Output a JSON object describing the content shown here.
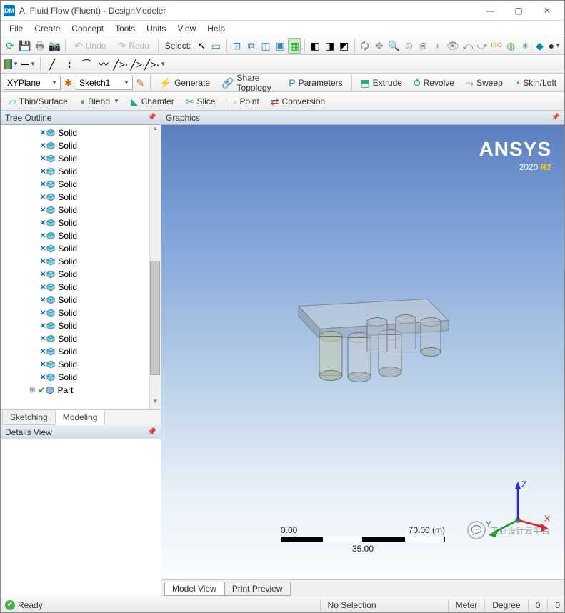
{
  "title": "A: Fluid Flow (Fluent) - DesignModeler",
  "window_controls": {
    "min": "—",
    "max": "▢",
    "close": "✕"
  },
  "menu": [
    "File",
    "Create",
    "Concept",
    "Tools",
    "Units",
    "View",
    "Help"
  ],
  "toolbar1": {
    "undo": "Undo",
    "redo": "Redo",
    "select": "Select:"
  },
  "toolbar3": {
    "plane": "XYPlane",
    "sketch": "Sketch1",
    "generate": "Generate",
    "share": "Share Topology",
    "params": "Parameters",
    "extrude": "Extrude",
    "revolve": "Revolve",
    "sweep": "Sweep",
    "skin": "Skin/Loft"
  },
  "toolbar4": {
    "thin": "Thin/Surface",
    "blend": "Blend",
    "chamfer": "Chamfer",
    "slice": "Slice",
    "point": "Point",
    "conversion": "Conversion"
  },
  "tree": {
    "title": "Tree Outline",
    "items": [
      "Solid",
      "Solid",
      "Solid",
      "Solid",
      "Solid",
      "Solid",
      "Solid",
      "Solid",
      "Solid",
      "Solid",
      "Solid",
      "Solid",
      "Solid",
      "Solid",
      "Solid",
      "Solid",
      "Solid",
      "Solid",
      "Solid",
      "Solid"
    ],
    "part": "Part"
  },
  "tree_tabs": {
    "sketching": "Sketching",
    "modeling": "Modeling"
  },
  "details": {
    "title": "Details View"
  },
  "graphics": {
    "title": "Graphics",
    "brand": "ANSYS",
    "version_a": "2020 ",
    "version_b": "R2",
    "scale_min": "0.00",
    "scale_max": "70.00 (m)",
    "scale_mid": "35.00",
    "watermark": "工业设计云平台",
    "axes": {
      "x": "X",
      "y": "Y",
      "z": "Z"
    },
    "tabs": {
      "model": "Model View",
      "print": "Print Preview"
    }
  },
  "status": {
    "ready": "Ready",
    "nosel": "No Selection",
    "unit": "Meter",
    "deg_lbl": "Degree",
    "deg": "0",
    "ext": "0"
  }
}
